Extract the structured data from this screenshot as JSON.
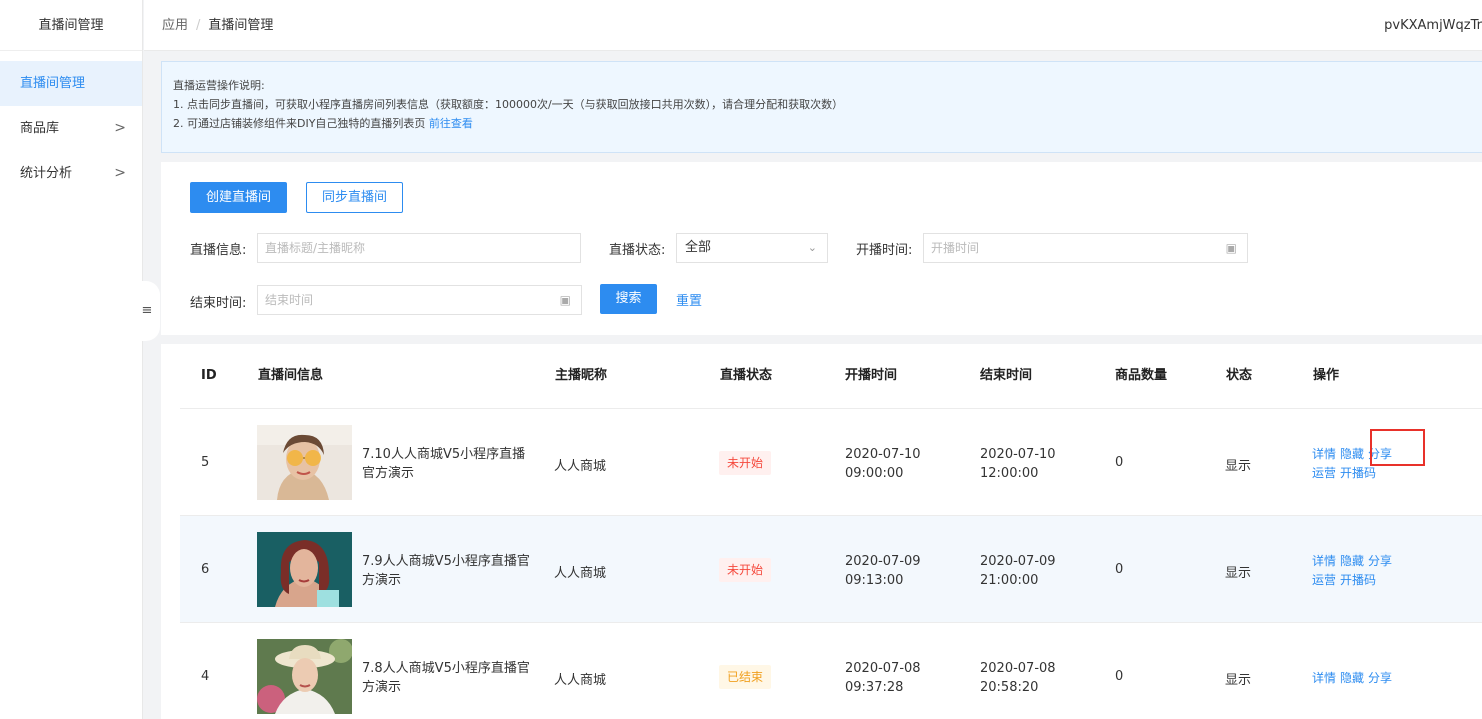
{
  "sidebar": {
    "title": "直播间管理",
    "items": [
      {
        "label": "直播间管理",
        "chevron": ""
      },
      {
        "label": "商品库",
        "chevron": ">"
      },
      {
        "label": "统计分析",
        "chevron": ">"
      }
    ],
    "collapse_icon": "≡"
  },
  "header": {
    "breadcrumb": [
      "应用",
      "直播间管理"
    ],
    "breadcrumb_sep": "/",
    "user": "pvKXAmjWqzTr"
  },
  "notice": {
    "title": "直播运营操作说明:",
    "line1": "1. 点击同步直播间，可获取小程序直播房间列表信息（获取额度：100000次/一天（与获取回放接口共用次数），请合理分配和获取次数）",
    "line2": "2. 可通过店铺装修组件来DIY自己独特的直播列表页 ",
    "link": "前往查看"
  },
  "toolbar": {
    "create_label": "创建直播间",
    "sync_label": "同步直播间"
  },
  "filters": {
    "info_label": "直播信息:",
    "info_placeholder": "直播标题/主播昵称",
    "status_label": "直播状态:",
    "status_value": "全部",
    "start_label": "开播时间:",
    "start_placeholder": "开播时间",
    "end_label": "结束时间:",
    "end_placeholder": "结束时间",
    "search_label": "搜索",
    "reset_label": "重置"
  },
  "table": {
    "headers": [
      "ID",
      "直播间信息",
      "主播昵称",
      "直播状态",
      "开播时间",
      "结束时间",
      "商品数量",
      "状态",
      "操作"
    ],
    "rows": [
      {
        "id": "5",
        "title1": "7.10人人商城V5小程序直播",
        "title2": "官方演示",
        "anchor": "人人商城",
        "live_status": "未开始",
        "start1": "2020-07-10",
        "start2": "09:00:00",
        "end1": "2020-07-10",
        "end2": "12:00:00",
        "goods": "0",
        "state": "显示",
        "ops1": [
          "详情",
          "隐藏",
          "分享"
        ],
        "ops2": [
          "运营",
          "开播码"
        ]
      },
      {
        "id": "6",
        "title1": "7.9人人商城V5小程序直播官",
        "title2": "方演示",
        "anchor": "人人商城",
        "live_status": "未开始",
        "start1": "2020-07-09",
        "start2": "09:13:00",
        "end1": "2020-07-09",
        "end2": "21:00:00",
        "goods": "0",
        "state": "显示",
        "ops1": [
          "详情",
          "隐藏",
          "分享"
        ],
        "ops2": [
          "运营",
          "开播码"
        ]
      },
      {
        "id": "4",
        "title1": "7.8人人商城V5小程序直播官",
        "title2": "方演示",
        "anchor": "人人商城",
        "live_status": "已结束",
        "start1": "2020-07-08",
        "start2": "09:37:28",
        "end1": "2020-07-08",
        "end2": "20:58:20",
        "goods": "0",
        "state": "显示",
        "ops1": [
          "详情",
          "隐藏",
          "分享"
        ],
        "ops2": []
      }
    ]
  },
  "colors": {
    "accent": "#2d8cf0",
    "tag_red": "#f5493d",
    "tag_orange": "#f0a020",
    "highlight": "#e8312a"
  }
}
